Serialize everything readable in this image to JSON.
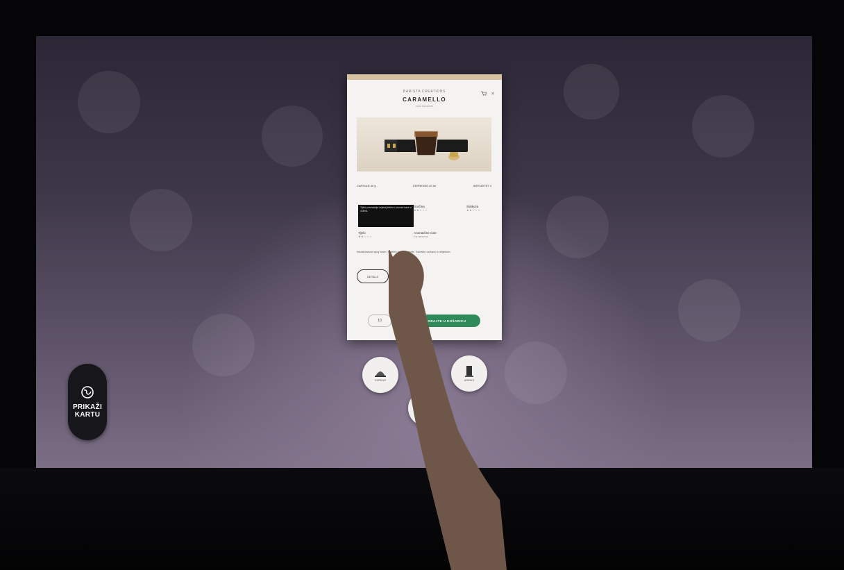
{
  "map_button": {
    "line1": "PRIKAŽI",
    "line2": "KARTU",
    "icon": "globe-icon"
  },
  "card": {
    "brand": "BARISTA CREATIONS",
    "name": "CARAMELLO",
    "subtitle": "okus karamele",
    "specs": [
      "CAPSULE 40 g",
      "ESPRESSO 40 ml",
      "INTENZITET 4"
    ],
    "attributes": [
      {
        "label": "Gorčina",
        "stars": "★★☆☆☆"
      },
      {
        "label": "Slatkoća",
        "stars": "★★☆☆☆"
      },
      {
        "label": "Tijelo",
        "stars": "★★☆☆☆"
      },
      {
        "label": "Aromatične note",
        "value": "Karamela"
      }
    ],
    "tooltip": "Tijelo predstavlja osjećaj težine i punoće kave u ustima.",
    "description": "Nezaboravan spoj kave i slatkih nota karamele. Savršen za kavu s mlijekom.",
    "details_label": "DETALJI",
    "quantity": "10",
    "add_label": "DODAJTE U KOŠARICU"
  },
  "nav": [
    {
      "label": "CAPSULE",
      "icon": "capsule-icon"
    },
    {
      "label": "APARATI",
      "icon": "machine-icon"
    },
    {
      "label": "",
      "icon": "home-icon"
    }
  ],
  "colors": {
    "accent": "#2f8a5a",
    "card_top": "#d6c2a0",
    "screen_bg": "#3d3648"
  }
}
